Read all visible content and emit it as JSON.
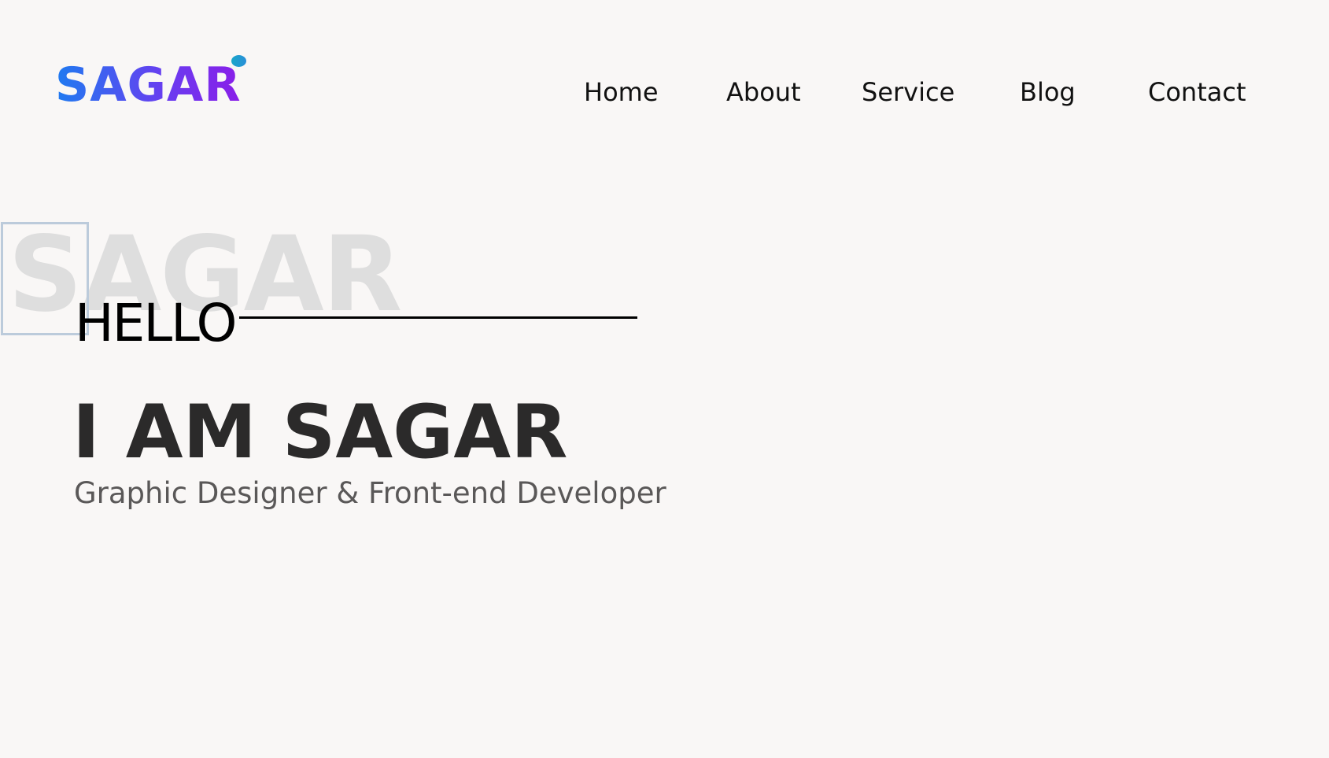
{
  "header": {
    "logo_text": "SAGAR",
    "nav": {
      "home": "Home",
      "about": "About",
      "service": "Service",
      "blog": "Blog",
      "contact": "Contact"
    }
  },
  "hero": {
    "watermark": "SAGAR",
    "greeting": "HELLO",
    "headline": "I AM SAGAR",
    "subtitle": "Graphic Designer & Front-end Developer"
  },
  "colors": {
    "background": "#f9f7f6",
    "logo_gradient_start": "#1f7bf0",
    "logo_gradient_end": "#8a1ee8",
    "logo_dot": "#1aa6c9",
    "headline": "#2b2a2a",
    "subtitle": "#5a5858",
    "watermark": "#dedede"
  }
}
